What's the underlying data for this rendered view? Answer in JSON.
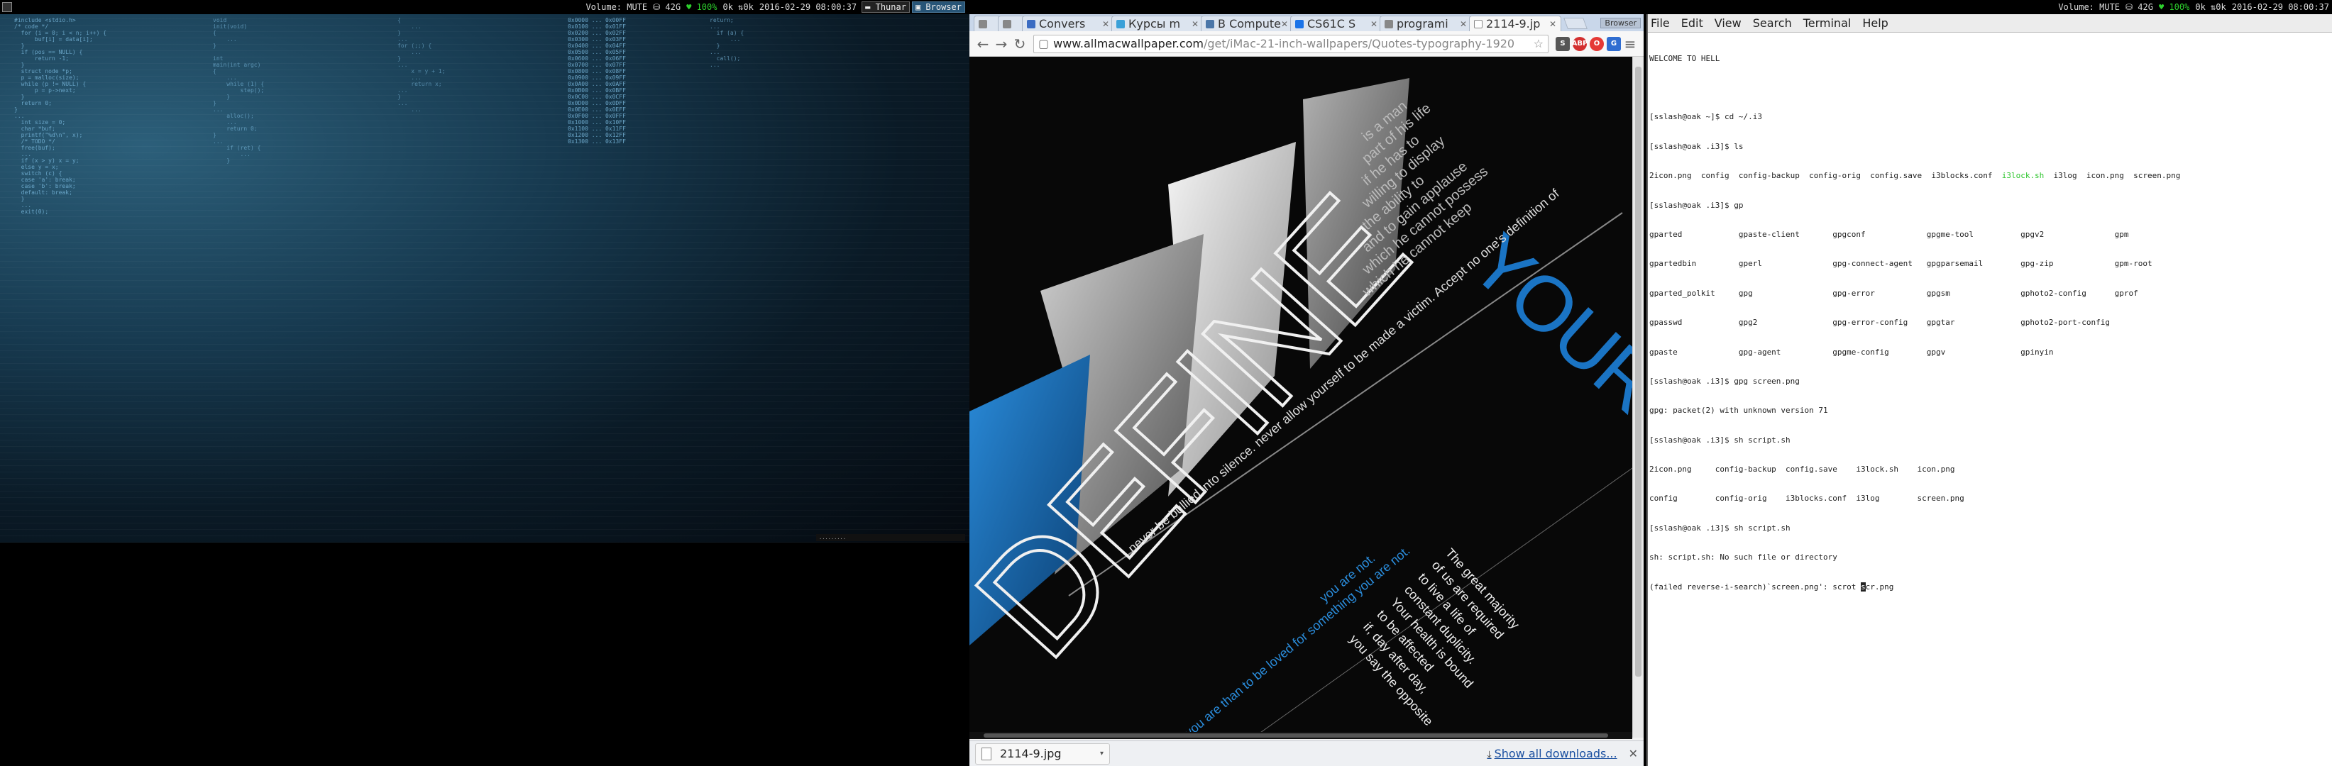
{
  "left_bar": {
    "volume": "Volume: MUTE",
    "disk": "⛁ 42G",
    "battery": "100%",
    "net": "0k ⇅0k",
    "datetime": "2016-02-29 08:00:37",
    "apps": [
      "Thunar",
      "Browser"
    ]
  },
  "right_bar": {
    "volume": "Volume: MUTE",
    "disk": "⛁ 42G",
    "battery": "100%",
    "net": "0k ⇅0k",
    "datetime": "2016-02-29 08:00:37"
  },
  "browser": {
    "tabs": [
      {
        "label": "Convers",
        "color": "#3b6cc2"
      },
      {
        "label": "Курсы m",
        "color": "#3aa0d8"
      },
      {
        "label": "В Compute",
        "color": "#4a76a8"
      },
      {
        "label": "CS61C S",
        "color": "#1a73e8"
      },
      {
        "label": "programi",
        "color": "#888888"
      },
      {
        "label": "2114-9.jp",
        "color": "#dddddd",
        "active": true
      }
    ],
    "window_caption": "Browser",
    "url_host": "www.allmacwallpaper.com",
    "url_path": "/get/iMac-21-inch-wallpapers/Quotes-typography-1920",
    "download_file": "2114-9.jpg",
    "show_all_downloads": "Show all downloads..."
  },
  "wallpaper_image": {
    "big_word": "DEFINE",
    "side_word": "YOURS",
    "lines_top": [
      "is a man",
      "part of his life",
      "if he has to",
      "willing to display",
      "the ability to",
      "and to gain applause",
      "which he cannot possess",
      "which he cannot keep"
    ],
    "diag_quote": "never be bullied into silence. never allow yourself to be made a victim. Accept no one's definition of",
    "bottom_blue": "you are not.",
    "bottom_quote": [
      "The great majority",
      "of us are required",
      "to live a life of",
      "constant duplicity.",
      "Your health is bound",
      "to be affected",
      "if, day after day,",
      "you say the opposite"
    ],
    "bottom_blue2": "you are than to be loved for something you are not."
  },
  "terminal": {
    "menu": [
      "File",
      "Edit",
      "View",
      "Search",
      "Terminal",
      "Help"
    ],
    "lines": [
      "WELCOME TO HELL",
      "",
      "[sslash@oak ~]$ cd ~/.i3",
      "[sslash@oak .i3]$ ls",
      "2icon.png  config  config-backup  config-orig  config.save  i3blocks.conf  i3lock.sh  i3log  icon.png  screen.png",
      "[sslash@oak .i3]$ gp",
      "gparted            gpaste-client       gpgconf             gpgme-tool          gpgv2               gpm",
      "gpartedbin         gperl               gpg-connect-agent   gpgparsemail        gpg-zip             gpm-root",
      "gparted_polkit     gpg                 gpg-error           gpgsm               gphoto2-config      gprof",
      "gpasswd            gpg2                gpg-error-config    gpgtar              gphoto2-port-config",
      "gpaste             gpg-agent           gpgme-config        gpgv                gpinyin",
      "[sslash@oak .i3]$ gpg screen.png",
      "gpg: packet(2) with unknown version 71",
      "[sslash@oak .i3]$ sh script.sh",
      "2icon.png     config-backup  config.save    i3lock.sh    icon.png",
      "config        config-orig    i3blocks.conf  i3log        screen.png",
      "[sslash@oak .i3]$ sh script.sh",
      "sh: script.sh: No such file or directory",
      "(failed reverse-i-search)`screen.png': scrot "
    ],
    "cursor_char": "s",
    "after_cursor": "cr.png"
  },
  "colors": {
    "lime": "#2ec52e",
    "accent_blue": "#1a74c4",
    "link": "#1a4fa0"
  }
}
